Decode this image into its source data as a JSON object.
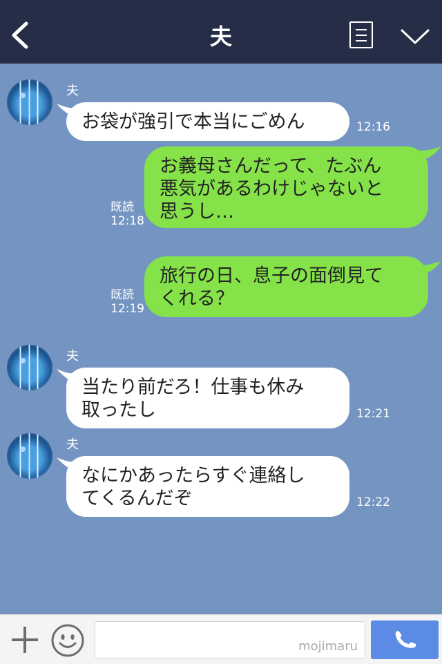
{
  "header": {
    "title": "夫"
  },
  "messages": [
    {
      "sender": "夫",
      "text": "お袋が強引で本当にごめん",
      "time": "12:16"
    },
    {
      "text": "お義母さんだって、たぶん\n悪気があるわけじゃないと\n思うし…",
      "status": "既読",
      "time": "12:18"
    },
    {
      "text": "旅行の日、息子の面倒見て\nくれる？",
      "status": "既読",
      "time": "12:19"
    },
    {
      "sender": "夫",
      "text": "当たり前だろ！仕事も休み\n取ったし",
      "time": "12:21"
    },
    {
      "sender": "夫",
      "text": "なにかあったらすぐ連絡し\nてくるんだぞ",
      "time": "12:22"
    }
  ],
  "input": {
    "watermark": "mojimaru"
  },
  "colors": {
    "header_bg": "#262e47",
    "chat_bg": "#7495c2",
    "outgoing_bubble": "#85e249",
    "incoming_bubble": "#ffffff",
    "call_button": "#5b8be4"
  },
  "icons": [
    "back-arrow-icon",
    "menu-icon",
    "chevron-down-icon",
    "plus-icon",
    "smile-icon",
    "phone-icon"
  ]
}
